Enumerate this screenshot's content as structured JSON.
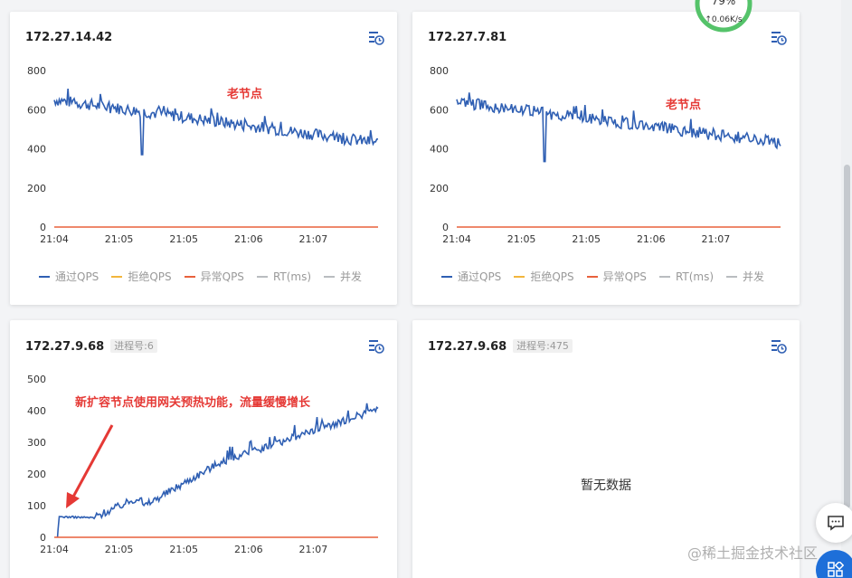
{
  "chart_data": [
    {
      "type": "line",
      "title": "172.27.14.42",
      "x_ticks": [
        "21:04",
        "21:05",
        "21:05",
        "21:06",
        "21:07"
      ],
      "ylim": [
        0,
        800
      ],
      "y_ticks": [
        0,
        200,
        400,
        600,
        800
      ],
      "annotation": "老节点",
      "series": [
        {
          "name": "通过QPS",
          "color": "#2f5fb3",
          "start": 650,
          "end": 430,
          "dip": {
            "at": 0.27,
            "value": 370
          },
          "noise": 30
        },
        {
          "name": "异常QPS",
          "color": "#e8613c",
          "value": 0
        }
      ],
      "legend": [
        "通过QPS",
        "拒绝QPS",
        "异常QPS",
        "RT(ms)",
        "并发"
      ]
    },
    {
      "type": "line",
      "title": "172.27.7.81",
      "x_ticks": [
        "21:04",
        "21:05",
        "21:05",
        "21:06",
        "21:07"
      ],
      "ylim": [
        0,
        800
      ],
      "y_ticks": [
        0,
        200,
        400,
        600,
        800
      ],
      "annotation": "老节点",
      "series": [
        {
          "name": "通过QPS",
          "color": "#2f5fb3",
          "start": 640,
          "end": 430,
          "dip": {
            "at": 0.27,
            "value": 335
          },
          "noise": 30
        },
        {
          "name": "异常QPS",
          "color": "#e8613c",
          "value": 0
        }
      ],
      "legend": [
        "通过QPS",
        "拒绝QPS",
        "异常QPS",
        "RT(ms)",
        "并发"
      ]
    },
    {
      "type": "line",
      "title": "172.27.9.68",
      "pid": "进程号:6",
      "x_ticks": [
        "21:04",
        "21:05",
        "21:05",
        "21:06",
        "21:07"
      ],
      "ylim": [
        0,
        500
      ],
      "y_ticks": [
        0,
        100,
        200,
        300,
        400,
        500
      ],
      "annotation": "新扩容节点使用网关预热功能，流量缓慢增长",
      "series": [
        {
          "name": "通过QPS",
          "color": "#2f5fb3",
          "segments": [
            [
              0.01,
              0
            ],
            [
              0.015,
              65
            ],
            [
              0.12,
              62
            ],
            [
              0.27,
              130
            ],
            [
              0.27,
              95
            ],
            [
              0.5,
              230
            ],
            [
              0.75,
              320
            ],
            [
              1.0,
              405
            ]
          ],
          "noise": 12
        },
        {
          "name": "异常QPS",
          "color": "#e8613c",
          "value": 0
        }
      ]
    },
    {
      "type": "line",
      "title": "172.27.9.68",
      "pid": "进程号:475",
      "empty_text": "暂无数据"
    }
  ],
  "legend_colors": {
    "通过QPS": "#2f5fb3",
    "拒绝QPS": "#f2b63c",
    "异常QPS": "#e8613c",
    "RT(ms)": "#b9bcc0",
    "并发": "#b9bcc0"
  },
  "annotation_color": "#e53935",
  "gauge": {
    "percent": "79%",
    "speed": "↑0.06K/s",
    "color": "#55c36a"
  },
  "watermark": "@稀土掘金技术社区",
  "icons": {
    "history": "history-icon",
    "comment": "comment-icon",
    "grid": "grid-icon"
  }
}
